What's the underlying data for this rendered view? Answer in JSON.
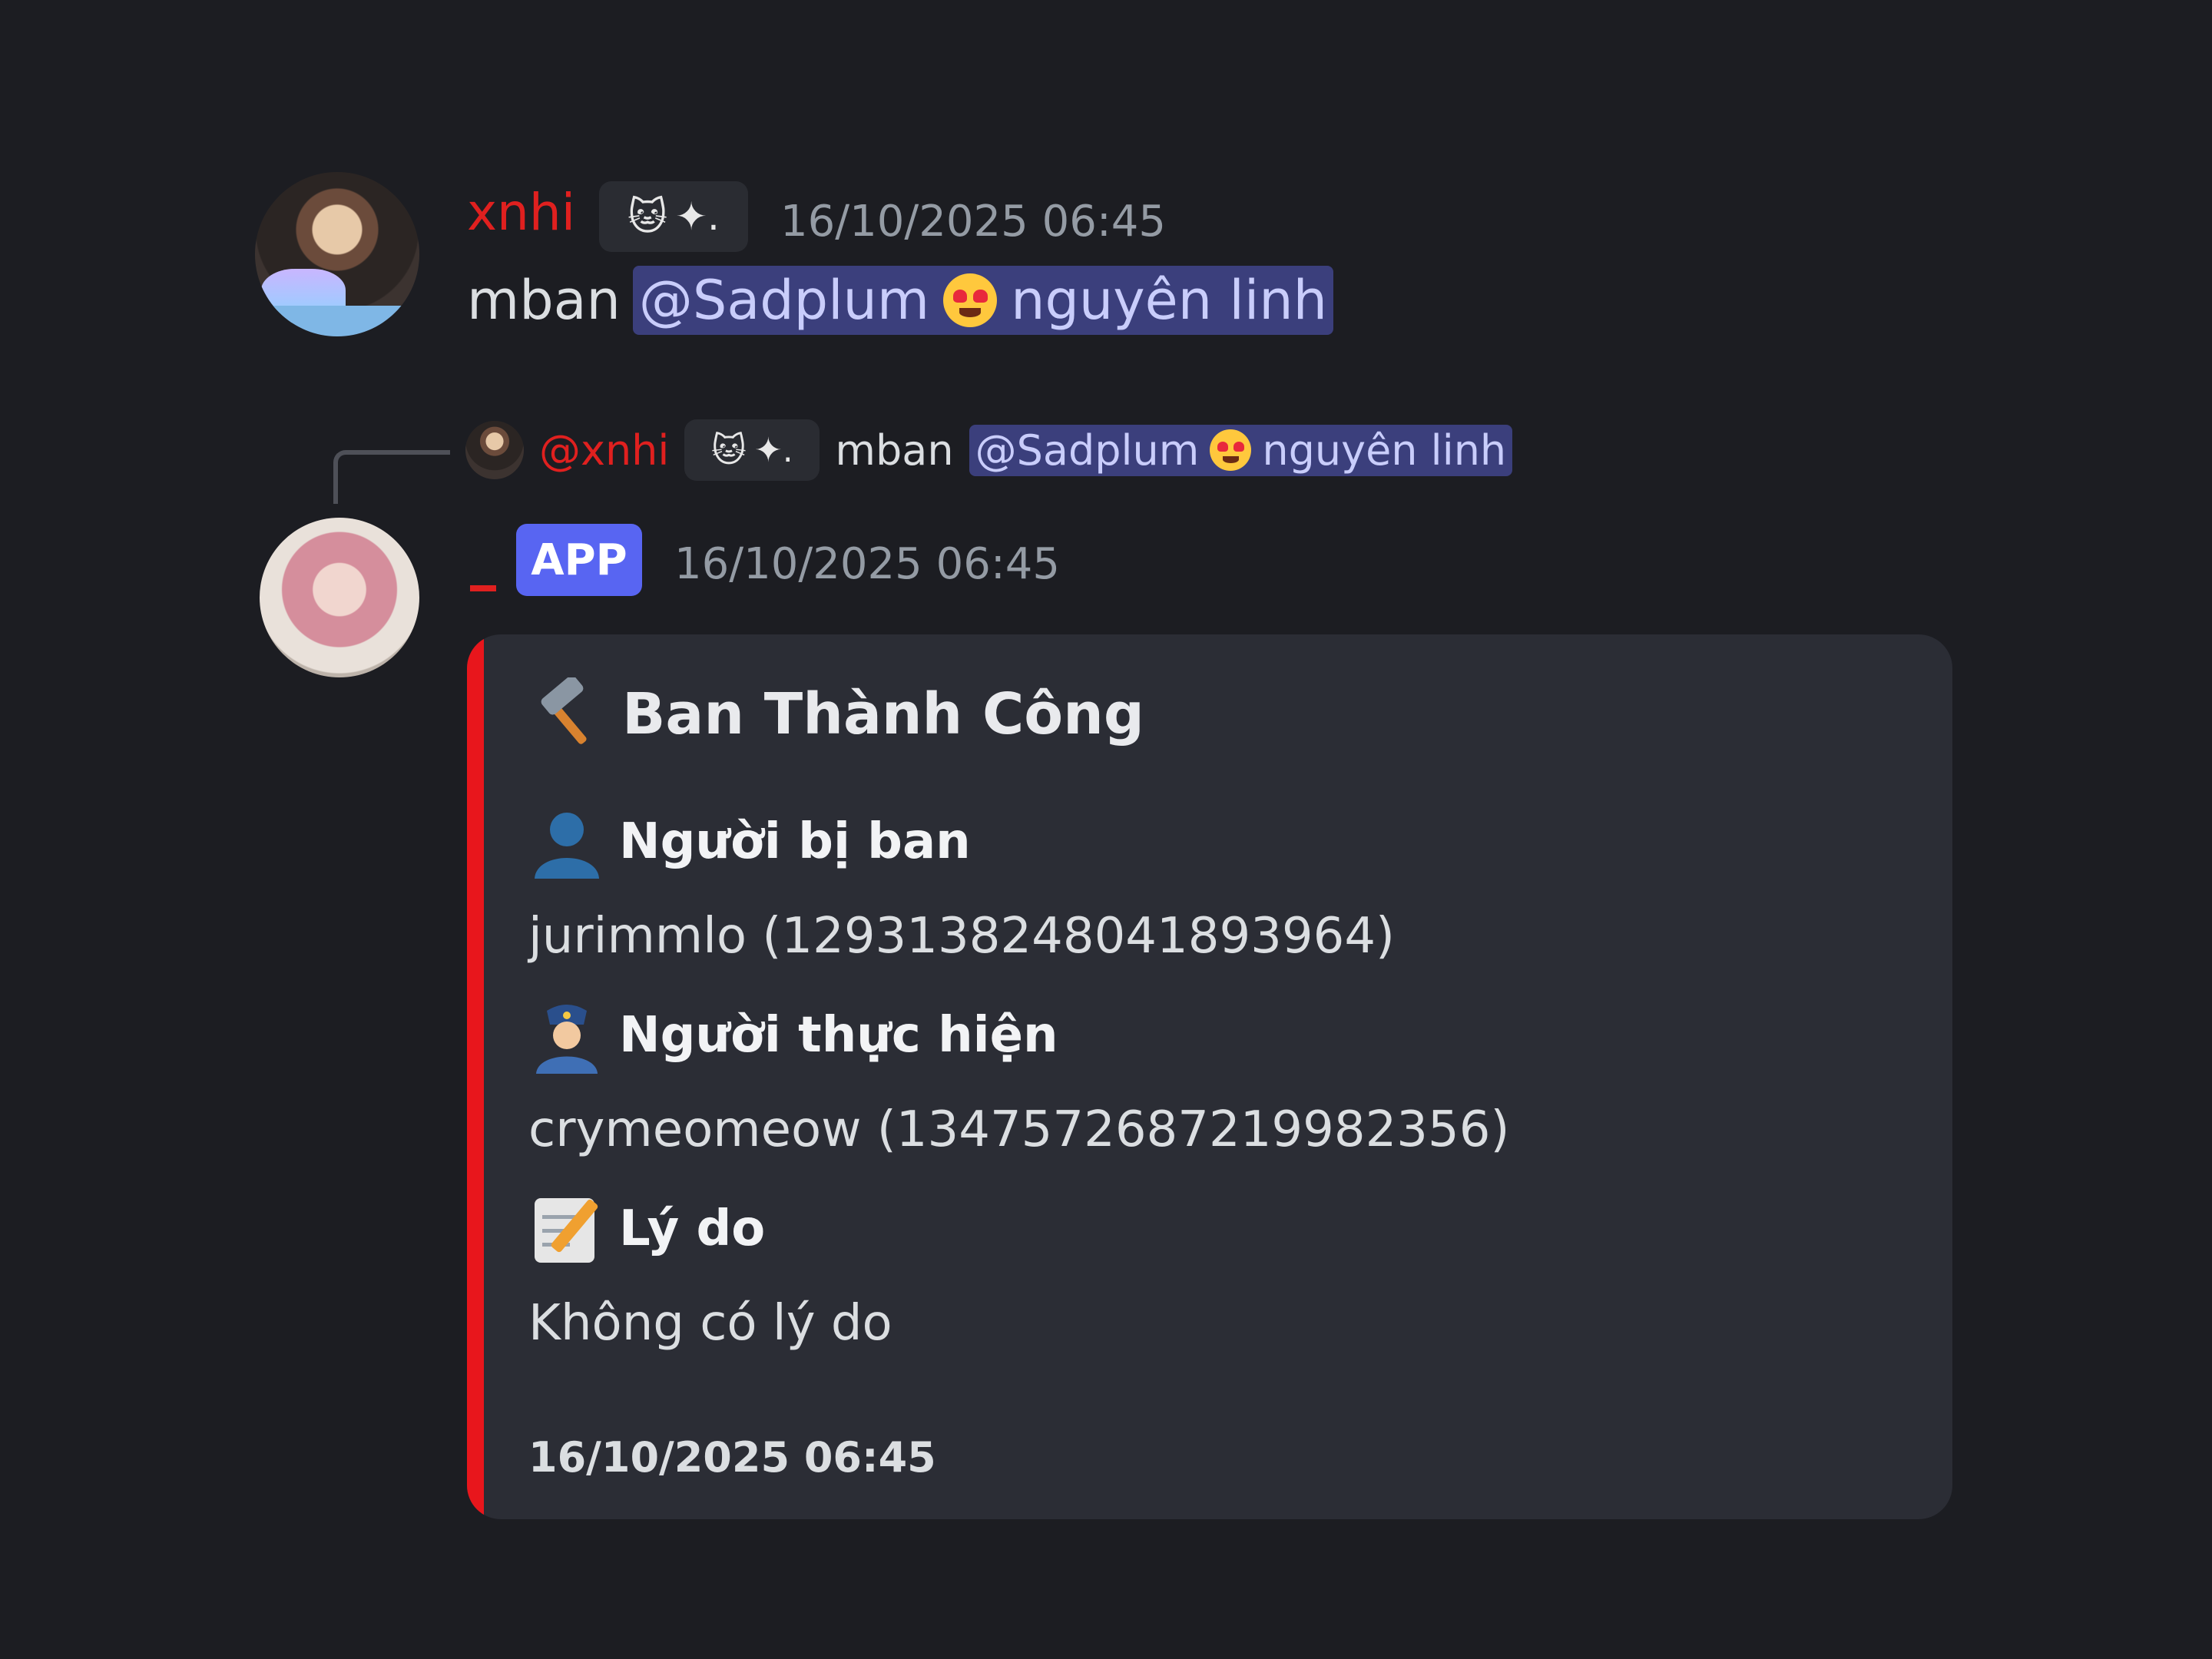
{
  "message1": {
    "username": "xnhi",
    "tag_icons": "🐱✦.",
    "timestamp": "16/10/2025 06:45",
    "text_prefix": "mban",
    "mention_name": "@Sadplum",
    "mention_suffix": "nguyên linh"
  },
  "reply": {
    "username": "@xnhi",
    "tag_icons": "🐱✦.",
    "text_prefix": "mban",
    "mention_name": "@Sadplum",
    "mention_suffix": "nguyên linh"
  },
  "message2": {
    "username": "_",
    "badge": "APP",
    "timestamp": "16/10/2025 06:45",
    "embed": {
      "accent_color": "#e8161c",
      "title": "Ban Thành Công",
      "fields": [
        {
          "name": "Người bị ban",
          "value": "jurimmlo (1293138248041893964)",
          "icon": "bust-icon"
        },
        {
          "name": "Người thực hiện",
          "value": "crymeomeow (1347572687219982356)",
          "icon": "police-officer-icon"
        },
        {
          "name": "Lý do",
          "value": "Không có lý do",
          "icon": "memo-icon"
        }
      ],
      "footer": "16/10/2025 06:45"
    }
  }
}
